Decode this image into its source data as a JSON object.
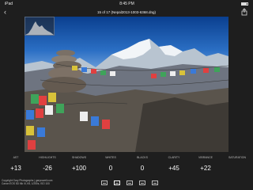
{
  "status_bar": {
    "carrier": "iPad",
    "time": "8:45 PM"
  },
  "header": {
    "back_icon": "chevron-left-icon",
    "title": "15 of 17 (Nepal2013-1003-6368.dng)",
    "share_icon": "share-icon"
  },
  "adjustments": {
    "labels": [
      "AST",
      "HIGHLIGHTS",
      "SHADOWS",
      "WHITES",
      "BLACKS",
      "CLARITY",
      "VIBRANCE",
      "SATURATION"
    ],
    "values": [
      "+13",
      "-26",
      "+100",
      "0",
      "0",
      "+45",
      "+22",
      ""
    ]
  },
  "caption": {
    "line1": "Copyright Gary Photographs | garyrowell.com",
    "line2": "Canon EOS 5D Mk III, f/8, 1/250s, ISO 100"
  },
  "toolbar": {
    "icons": [
      "filmstrip-icon",
      "adjust-icon",
      "crop-icon",
      "presets-icon",
      "info-icon"
    ],
    "active": "adjust-icon"
  }
}
